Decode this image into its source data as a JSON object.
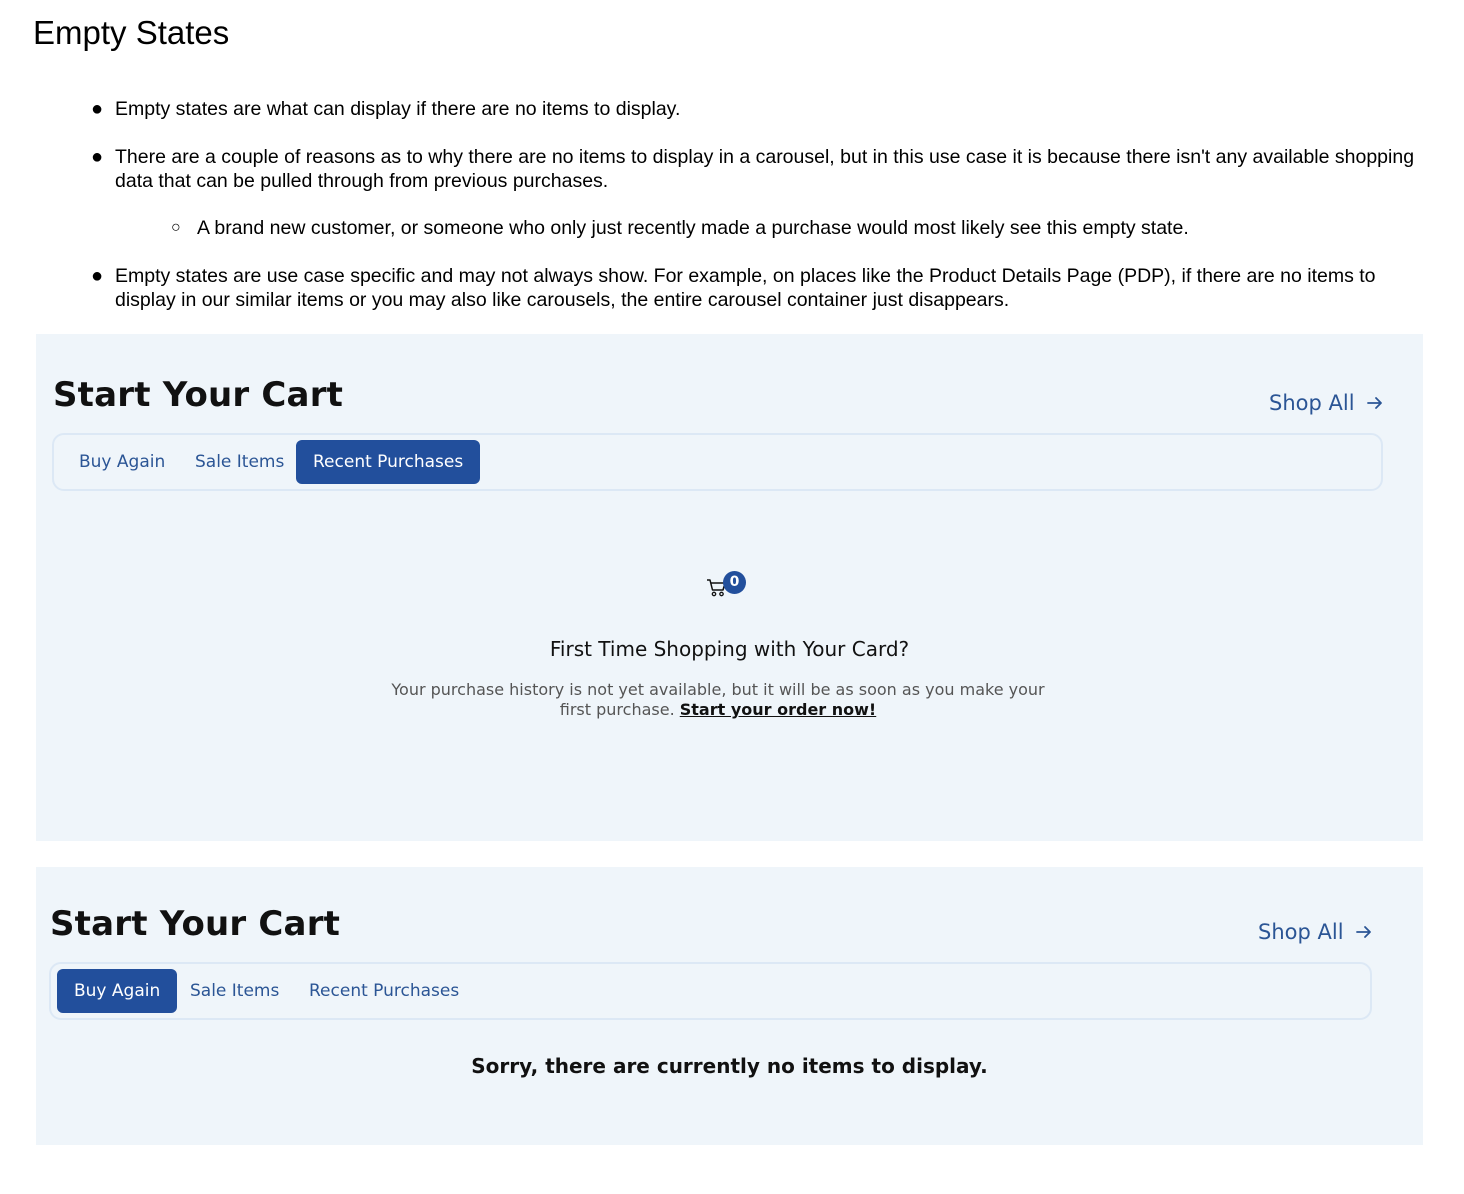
{
  "document": {
    "title": "Empty States",
    "bullets": [
      "Empty states are what can display if there are no items to display.",
      "There are a couple of reasons as to why there are no items to display in a carousel, but in this use case it is because there isn't any available shopping data that can be pulled through from previous purchases.",
      "A brand new customer, or someone who only just recently made a purchase would most likely see this empty state.",
      "Empty states are use case specific and may not always show. For example, on places like the Product Details Page (PDP), if there are no items to display in our similar items or you may also like carousels, the entire carousel container just disappears."
    ]
  },
  "panel1": {
    "title": "Start Your Cart",
    "shop_all": "Shop All",
    "tabs": [
      "Buy Again",
      "Sale Items",
      "Recent Purchases"
    ],
    "active_tab": "Recent Purchases",
    "cart_badge": "0",
    "empty_heading": "First Time Shopping with Your Card?",
    "empty_text": "Your purchase history is not yet available, but it will be as soon as you make your first purchase.",
    "empty_link": "Start your order now!"
  },
  "panel2": {
    "title": "Start Your Cart",
    "shop_all": "Shop All",
    "tabs": [
      "Buy Again",
      "Sale Items",
      "Recent Purchases"
    ],
    "active_tab": "Buy Again",
    "no_items": "Sorry, there are currently no items to display."
  },
  "colors": {
    "panel_bg": "#eff5fa",
    "accent": "#224f9c",
    "link": "#2b5595"
  },
  "icons": [
    "arrow-right-icon",
    "shopping-cart-icon"
  ]
}
